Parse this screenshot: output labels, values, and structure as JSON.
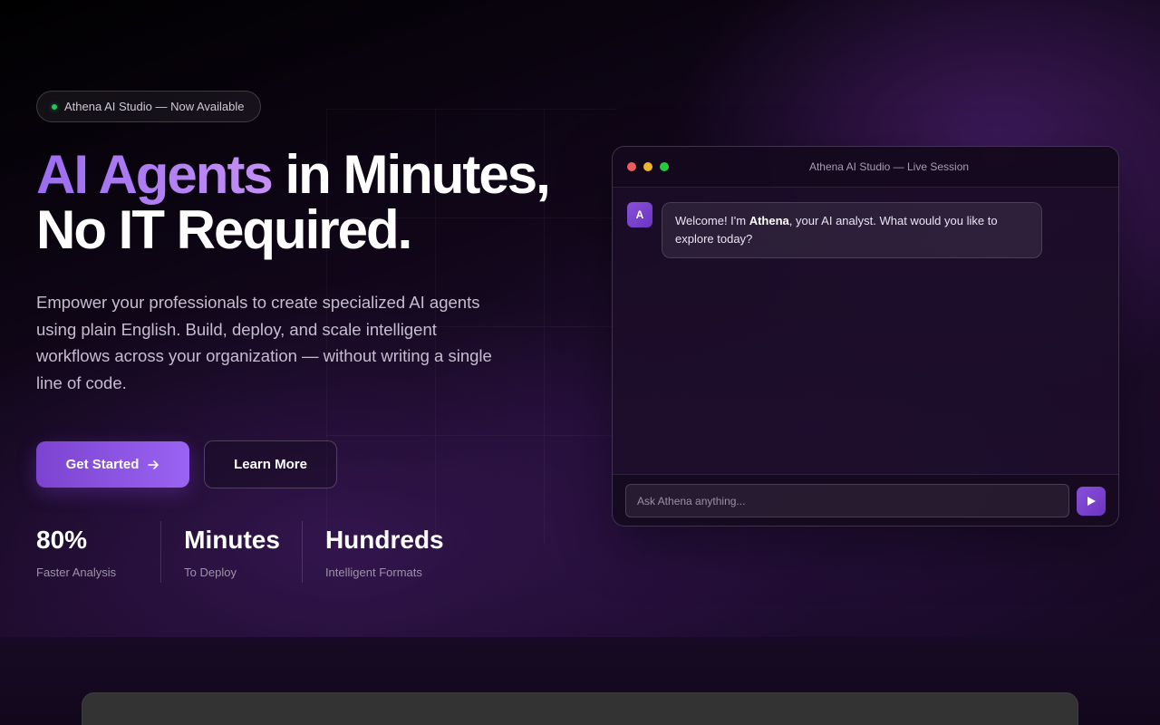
{
  "badge": {
    "text": "Athena AI Studio — Now Available",
    "dot_color": "#22c55e"
  },
  "hero": {
    "headline_accent": "AI Agents",
    "headline_rest": " in Minutes,",
    "headline_line2": "No IT Required.",
    "subtitle": "Empower your professionals to create specialized AI agents using plain English. Build, deploy, and scale intelligent workflows across your organization — without writing a single line of code."
  },
  "actions": {
    "primary_label": "Get Started",
    "primary_icon": "arrow-right-icon",
    "secondary_label": "Learn More"
  },
  "stats": [
    {
      "value": "80%",
      "label": "Faster Analysis"
    },
    {
      "value": "Minutes",
      "label": "To Deploy"
    },
    {
      "value": "Hundreds",
      "label": "Intelligent Formats"
    }
  ],
  "chat": {
    "title": "Athena AI Studio — Live Session",
    "avatar_initial": "A",
    "message": {
      "prefix": "Welcome! I'm ",
      "name": "Athena",
      "suffix": ", your AI analyst. What would you like to explore today?"
    },
    "input_placeholder": "Ask Athena anything...",
    "send_icon": "send-play-icon"
  },
  "colors": {
    "accent": "#9b63f3",
    "accent_dark": "#7b43cf",
    "background": "#0b0410"
  }
}
